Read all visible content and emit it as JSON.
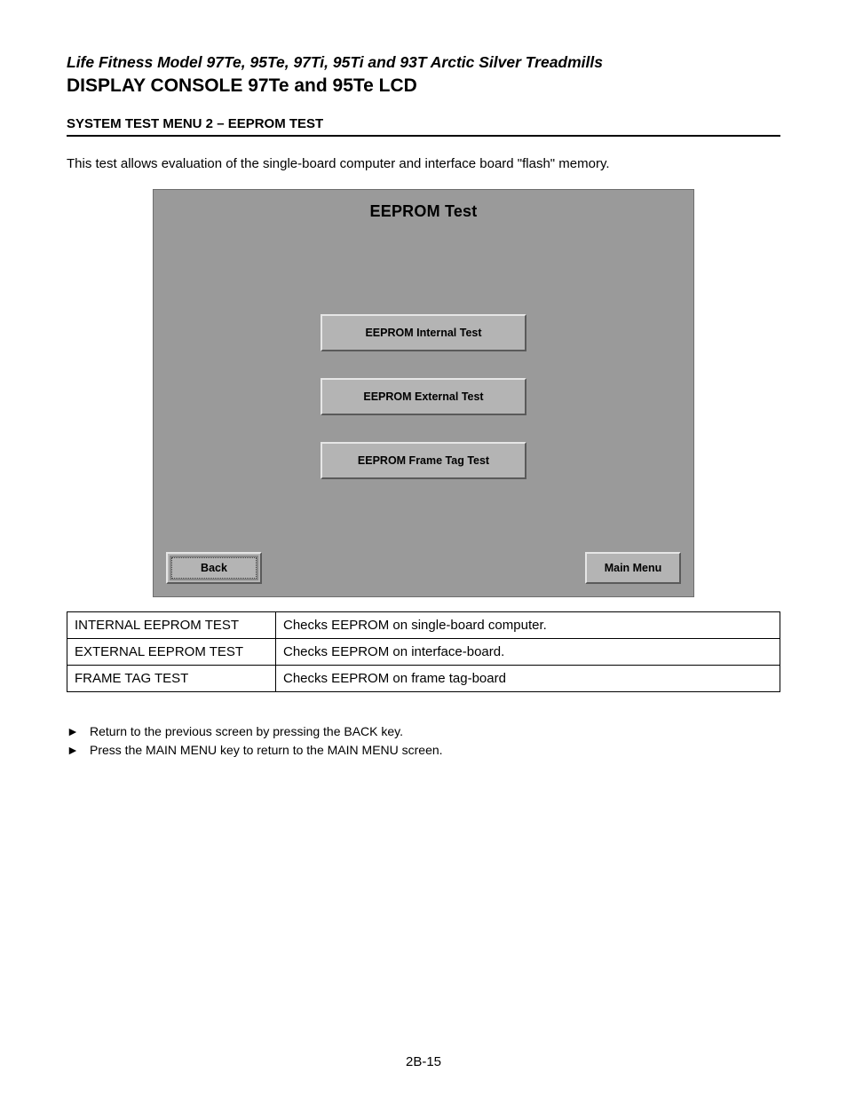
{
  "header": {
    "supertitle": "Life Fitness Model 97Te, 95Te, 97Ti, 95Ti and 93T Arctic Silver Treadmills",
    "title": "DISPLAY CONSOLE 97Te and 95Te LCD",
    "section": "SYSTEM TEST MENU 2 – EEPROM TEST"
  },
  "intro": "This test allows evaluation of the single-board computer and interface board \"flash\" memory.",
  "screen": {
    "title": "EEPROM Test",
    "buttons": {
      "internal": "EEPROM Internal Test",
      "external": "EEPROM External Test",
      "frametag": "EEPROM Frame Tag Test"
    },
    "nav": {
      "back": "Back",
      "mainmenu": "Main Menu"
    }
  },
  "table": {
    "rows": [
      {
        "name": "INTERNAL EEPROM TEST",
        "desc": "Checks EEPROM on single-board computer."
      },
      {
        "name": "EXTERNAL EEPROM TEST",
        "desc": "Checks EEPROM on interface-board."
      },
      {
        "name": "FRAME TAG TEST",
        "desc": "Checks EEPROM on frame tag-board"
      }
    ]
  },
  "bullets": {
    "arrow": "►",
    "items": [
      "Return to the previous screen by pressing the BACK key.",
      "Press the MAIN MENU key to return to the MAIN MENU screen."
    ]
  },
  "page": "2B-15"
}
